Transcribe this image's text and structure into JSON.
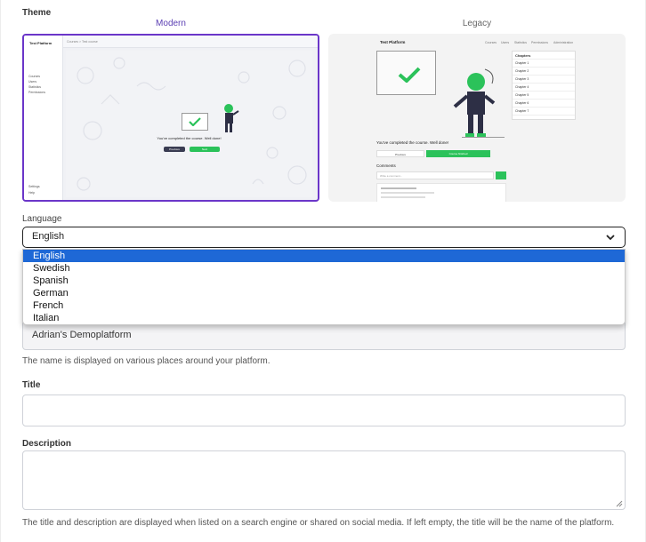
{
  "theme": {
    "label": "Theme",
    "options": [
      {
        "name": "Modern",
        "selected": true,
        "preview": {
          "brand": "Test Platform",
          "nav": [
            "Courses",
            "Users",
            "Statistics",
            "Permissions"
          ],
          "bottom_nav": [
            "Settings",
            "Help"
          ],
          "breadcrumb": "Courses  >  Test course",
          "message": "You've completed the course. Well done!",
          "buttons": [
            "Previous",
            "Next"
          ]
        }
      },
      {
        "name": "Legacy",
        "selected": false,
        "preview": {
          "brand": "Test Platform",
          "nav": [
            "Courses",
            "Users",
            "Statistics",
            "Permissions",
            "Administration"
          ],
          "chapters_heading": "Chapters",
          "chapters": [
            "Chapter 1",
            "Chapter 2",
            "Chapter 3",
            "Chapter 4",
            "Chapter 5",
            "Chapter 6",
            "Chapter 7"
          ],
          "message": "You've completed the course. Well done!",
          "buttons": [
            "Previous",
            "Course finished"
          ],
          "comments_heading": "Comments",
          "comment_placeholder": "Write a comment..."
        }
      }
    ]
  },
  "language": {
    "label": "Language",
    "selected": "English",
    "options": [
      "English",
      "Swedish",
      "Spanish",
      "German",
      "French",
      "Italian"
    ]
  },
  "name_field": {
    "value": "Adrian's Demoplatform",
    "help": "The name is displayed on various places around your platform."
  },
  "title_field": {
    "label": "Title",
    "value": ""
  },
  "description_field": {
    "label": "Description",
    "value": "",
    "help": "The title and description are displayed when listed on a search engine or shared on social media. If left empty, the title will be the name of the platform."
  },
  "colors": {
    "accent_purple": "#6b36c9",
    "select_highlight": "#1e68d6",
    "success_green": "#2bc25a"
  }
}
